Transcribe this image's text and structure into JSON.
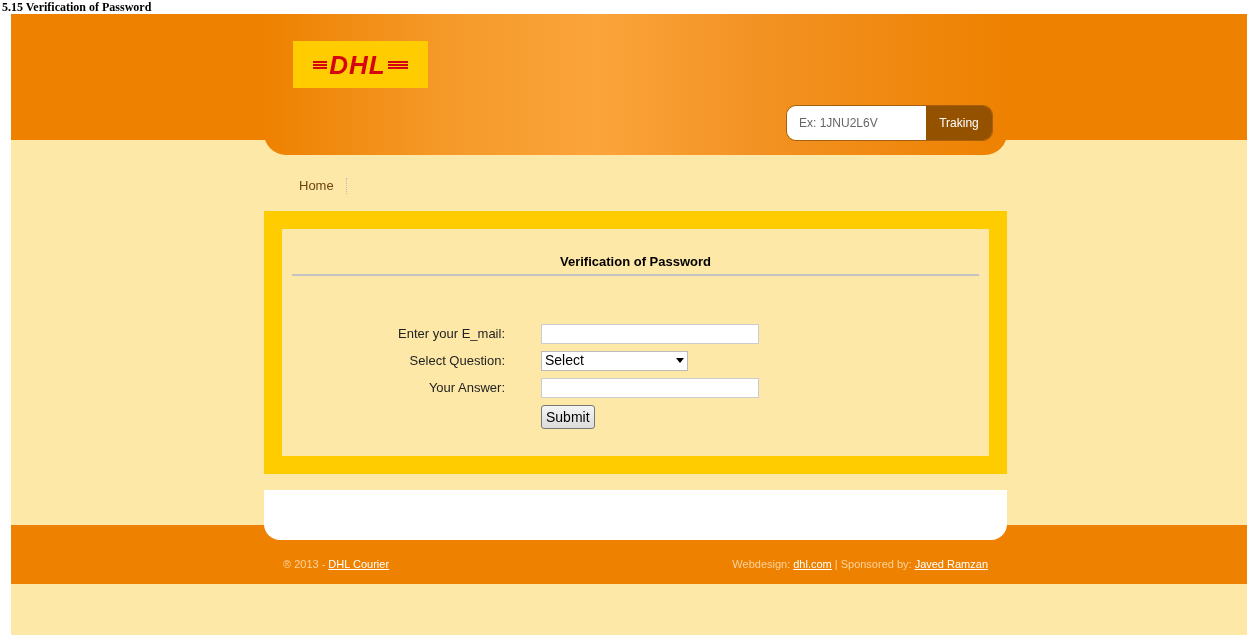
{
  "document_heading": "5.15 Verification of Password",
  "logo": {
    "text": "DHL"
  },
  "tracking": {
    "placeholder": "Ex: 1JNU2L6V",
    "button": "Traking"
  },
  "nav": [
    {
      "label": "Home"
    }
  ],
  "form": {
    "title": "Verification of Password",
    "fields": [
      {
        "kind": "text",
        "label": "Enter your E_mail:"
      },
      {
        "kind": "select",
        "label": "Select Question:",
        "value": "Select"
      },
      {
        "kind": "text",
        "label": "Your Answer:"
      }
    ],
    "submit": "Submit"
  },
  "footer": {
    "left_text": "® 2013 -",
    "left_link": "DHL Courier",
    "right": [
      {
        "kind": "text",
        "text": "Webdesign:"
      },
      {
        "kind": "link",
        "text": "dhl.com"
      },
      {
        "kind": "text",
        "text": "| Sponsored by:"
      },
      {
        "kind": "link",
        "text": "Javed Ramzan"
      }
    ]
  }
}
